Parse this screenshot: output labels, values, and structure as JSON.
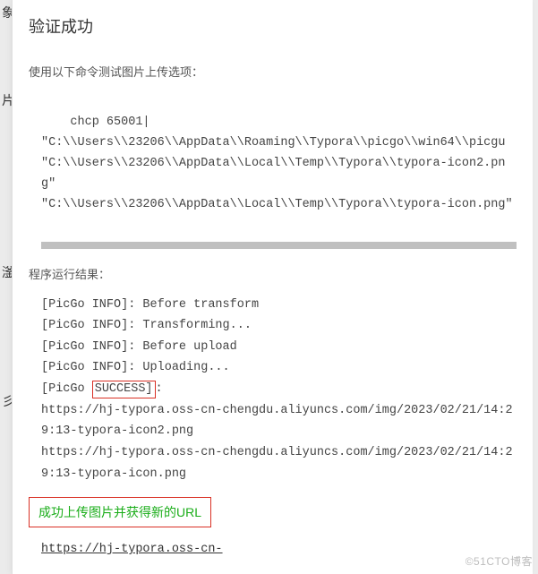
{
  "bg": {
    "label1": "象",
    "label2": "片",
    "label3": "滏",
    "label4": "彡"
  },
  "dialog": {
    "title": "验证成功",
    "instruction": "使用以下命令测试图片上传选项：",
    "command_lines": [
      "chcp 65001|",
      "\"C:\\\\Users\\\\23206\\\\AppData\\\\Roaming\\\\Typora\\\\picgo\\\\win64\\\\picgu \"C:\\\\Users\\\\23206\\\\AppData\\\\Local\\\\Temp\\\\Typora\\\\typora-icon2.png\"",
      "\"C:\\\\Users\\\\23206\\\\AppData\\\\Local\\\\Temp\\\\Typora\\\\typora-icon.png\""
    ],
    "result_label": "程序运行结果：",
    "result_lines": [
      "[PicGo INFO]: Before transform",
      "[PicGo INFO]: Transforming...",
      "[PicGo INFO]: Before upload",
      "[PicGo INFO]: Uploading..."
    ],
    "success_prefix": "[PicGo ",
    "success_word": "SUCCESS]",
    "success_suffix": ":",
    "url_lines": [
      "https://hj-typora.oss-cn-chengdu.aliyuncs.com/img/2023/02/21/14:29:13-typora-icon2.png",
      "https://hj-typora.oss-cn-chengdu.aliyuncs.com/img/2023/02/21/14:29:13-typora-icon.png"
    ],
    "success_banner": "成功上传图片并获得新的URL",
    "footer_link": "https://hj-typora.oss-cn-"
  },
  "watermark": "©51CTO博客"
}
